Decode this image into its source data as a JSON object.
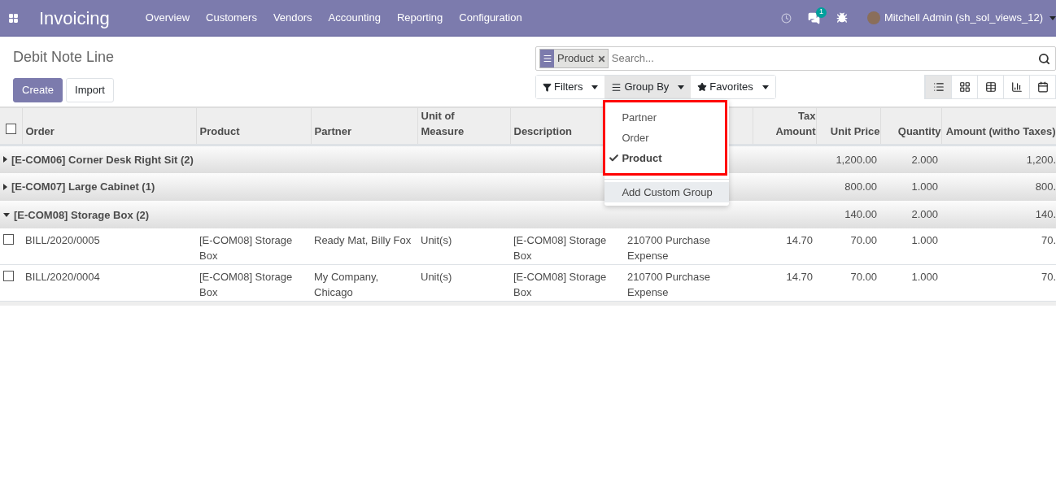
{
  "navbar": {
    "app_name": "Invoicing",
    "menus": [
      "Overview",
      "Customers",
      "Vendors",
      "Accounting",
      "Reporting",
      "Configuration"
    ],
    "chat_badge": "1",
    "user": "Mitchell Admin (sh_sol_views_12)"
  },
  "breadcrumb": "Debit Note Line",
  "buttons": [
    {
      "label": "Create",
      "kind": "primary"
    },
    {
      "label": "Import",
      "kind": "secondary"
    }
  ],
  "search": {
    "facets": [
      "Product"
    ],
    "placeholder": "Search..."
  },
  "search_panel": [
    {
      "label": "Filters",
      "kind": "filter",
      "open": false
    },
    {
      "label": "Group By",
      "kind": "group",
      "open": true
    },
    {
      "label": "Favorites",
      "kind": "star",
      "open": false
    }
  ],
  "group_by_menu": {
    "items": [
      {
        "label": "Partner",
        "checked": false
      },
      {
        "label": "Order",
        "checked": false
      },
      {
        "label": "Product",
        "checked": true
      }
    ],
    "custom": "Add Custom Group"
  },
  "views": [
    {
      "kind": "list",
      "selected": true
    },
    {
      "kind": "kanban",
      "selected": false
    },
    {
      "kind": "pivot",
      "selected": false
    },
    {
      "kind": "graph",
      "selected": false
    },
    {
      "kind": "calendar",
      "selected": false
    }
  ],
  "table": {
    "select_all_checked": false,
    "columns": [
      {
        "label": "Order",
        "kind": "text"
      },
      {
        "label": "Product",
        "kind": "text"
      },
      {
        "label": "Partner",
        "kind": "text"
      },
      {
        "label": "Unit of Measure",
        "kind": "text"
      },
      {
        "label": "Description",
        "kind": "text"
      },
      {
        "kind": "text"
      },
      {
        "label": "Tax Amount",
        "kind": "number"
      },
      {
        "label": "Unit Price",
        "kind": "number"
      },
      {
        "label": "Quantity",
        "kind": "number"
      },
      {
        "label": "Amount (witho Taxes)",
        "kind": "number"
      }
    ],
    "groups": [
      {
        "label": "[E-COM06] Corner Desk Right Sit (2)",
        "expanded": false,
        "unit_price": "1,200.00",
        "quantity": "2.000",
        "amount": "1,200."
      },
      {
        "label": "[E-COM07] Large Cabinet (1)",
        "expanded": false,
        "unit_price": "800.00",
        "quantity": "1.000",
        "amount": "800."
      },
      {
        "label": "[E-COM08] Storage Box (2)",
        "expanded": true,
        "unit_price": "140.00",
        "quantity": "2.000",
        "amount": "140.",
        "rows": [
          {
            "checked": false,
            "cells": [
              "BILL/2020/0005",
              "[E-COM08] Storage Box",
              "Ready Mat, Billy Fox",
              "Unit(s)",
              "[E-COM08] Storage Box",
              "210700 Purchase Expense",
              "14.70",
              "70.00",
              "1.000",
              "70."
            ]
          },
          {
            "checked": false,
            "cells": [
              "BILL/2020/0004",
              "[E-COM08] Storage Box",
              "My Company, Chicago",
              "Unit(s)",
              "[E-COM08] Storage Box",
              "210700 Purchase Expense",
              "14.70",
              "70.00",
              "1.000",
              "70."
            ]
          }
        ]
      }
    ]
  }
}
